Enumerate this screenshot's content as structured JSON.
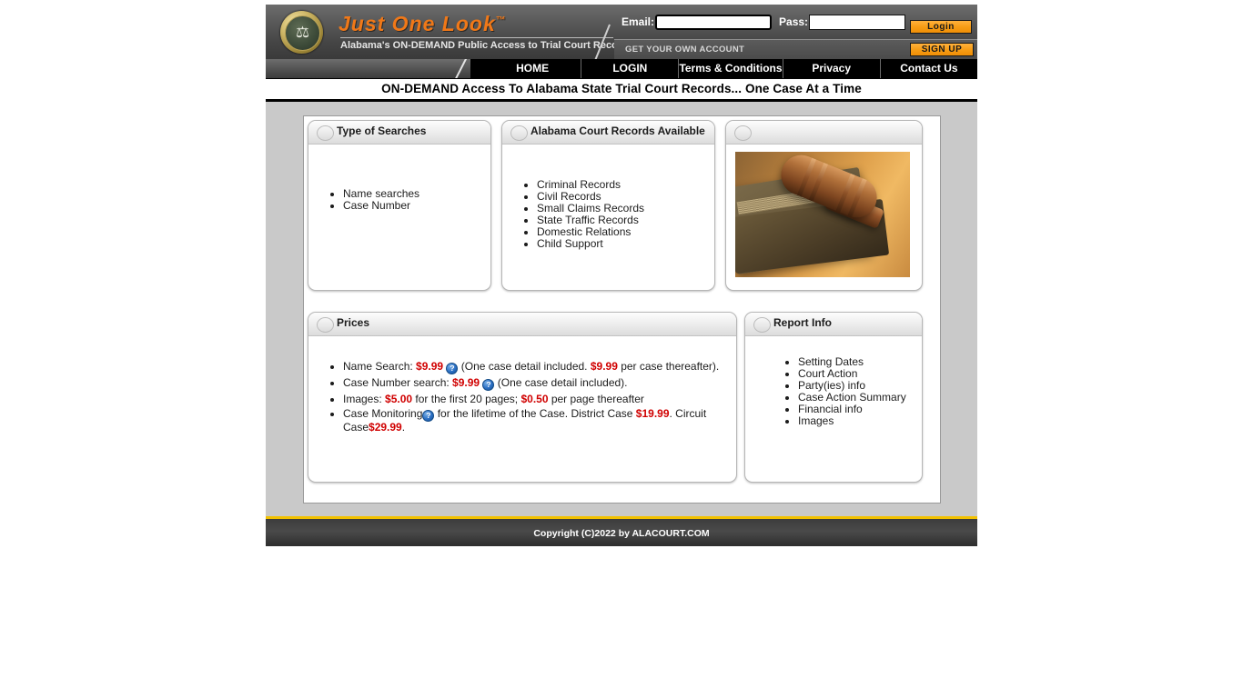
{
  "header": {
    "brand_title": "Just One Look",
    "brand_tm": "™",
    "brand_subtitle": "Alabama's ON-DEMAND Public Access to Trial Court Records",
    "seal_icon": "scales-of-justice-seal",
    "email_label": "Email:",
    "email_value": "",
    "pass_label": "Pass:",
    "pass_value": "",
    "login_label": "Login",
    "get_account_label": "GET YOUR OWN ACCOUNT",
    "signup_label": "SIGN UP",
    "accent_orange": "#f07818",
    "button_orange": "#f79d16"
  },
  "nav": {
    "items": [
      {
        "label": "HOME"
      },
      {
        "label": "LOGIN"
      },
      {
        "label": "Terms & Conditions"
      },
      {
        "label": "Privacy"
      },
      {
        "label": "Contact Us"
      }
    ]
  },
  "tagline": "ON-DEMAND Access To Alabama State Trial Court Records... One Case At a Time",
  "panels": {
    "searches": {
      "title": "Type of Searches",
      "items": [
        "Name searches",
        "Case Number"
      ]
    },
    "records": {
      "title": "Alabama Court Records Available",
      "items": [
        "Criminal Records",
        "Civil Records",
        "Small Claims Records",
        "State Traffic Records",
        "Domestic Relations",
        "Child Support"
      ]
    },
    "image": {
      "title": "",
      "image_name": "gavel-on-law-books-photo"
    },
    "prices": {
      "title": "Prices",
      "help_glyph": "?",
      "items": [
        {
          "pre": "Name Search: ",
          "price1": "$9.99",
          "help": true,
          "mid": " (One case detail included. ",
          "price2": "$9.99",
          "post": " per case thereafter)."
        },
        {
          "pre": "Case Number search: ",
          "price1": "$9.99",
          "help": true,
          "mid": " (One case detail included).",
          "price2": "",
          "post": ""
        },
        {
          "pre": "Images: ",
          "price1": "$5.00",
          "help": false,
          "mid": " for the first 20 pages; ",
          "price2": "$0.50",
          "post": " per page thereafter"
        },
        {
          "pre": "Case Monitoring",
          "price1": "",
          "help": true,
          "mid": " for the lifetime of the Case. District Case ",
          "price2": "$19.99",
          "post": ". Circuit Case",
          "price3": "$29.99",
          "post2": "."
        }
      ],
      "price_color": "#d00000"
    },
    "report": {
      "title": "Report Info",
      "items": [
        "Setting Dates",
        "Court Action",
        "Party(ies)  info",
        "Case Action Summary",
        "Financial info",
        "Images"
      ]
    }
  },
  "footer": {
    "copyright": "Copyright (C)2022 by ALACOURT.COM",
    "rule_color": "#f2c100"
  }
}
